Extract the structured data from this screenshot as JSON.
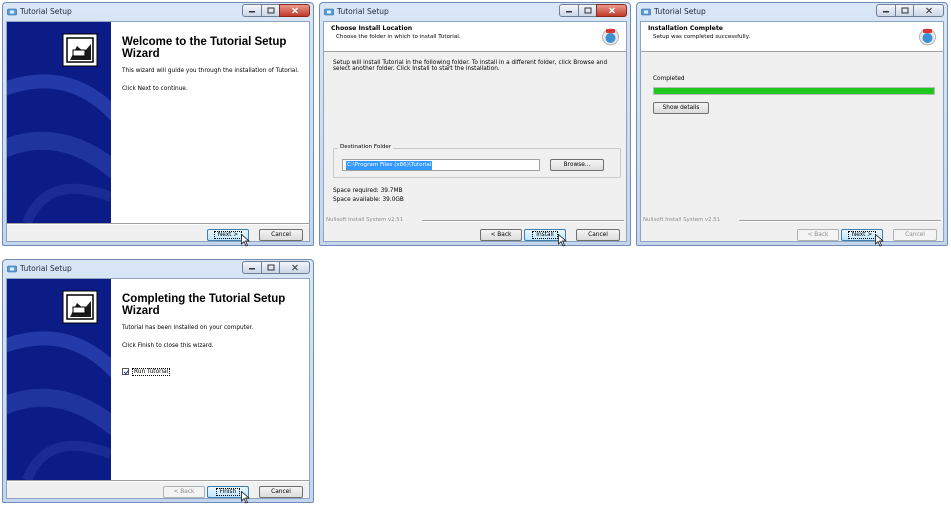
{
  "colors": {
    "side_panel": "#0c1c86",
    "progress_fill": "#1ec81e",
    "selection": "#3399ff"
  },
  "windows": {
    "welcome": {
      "title": "Tutorial Setup",
      "heading": "Welcome to the Tutorial Setup Wizard",
      "body1": "This wizard will guide you through the installation of Tutorial.",
      "body2": "Click Next to continue.",
      "next": "Next >",
      "cancel": "Cancel"
    },
    "location": {
      "title": "Tutorial Setup",
      "header_title": "Choose Install Location",
      "header_sub": "Choose the folder in which to install Tutorial.",
      "body": "Setup will install Tutorial in the following folder. To install in a different folder, click Browse and select another folder. Click Install to start the installation.",
      "dest_label": "Destination Folder",
      "dest_value": "C:\\Program Files (x86)\\Tutorial",
      "browse": "Browse...",
      "space_required": "Space required: 39.7MB",
      "space_available": "Space available: 39.0GB",
      "branding": "Nullsoft Install System v2.51",
      "back": "< Back",
      "install": "Install",
      "cancel": "Cancel"
    },
    "complete": {
      "title": "Tutorial Setup",
      "header_title": "Installation Complete",
      "header_sub": "Setup was completed successfully.",
      "status": "Completed",
      "progress_percent": 100,
      "show_details": "Show details",
      "branding": "Nullsoft Install System v2.51",
      "back": "< Back",
      "next": "Next >",
      "cancel": "Cancel"
    },
    "finish": {
      "title": "Tutorial Setup",
      "heading": "Completing the Tutorial Setup Wizard",
      "body1": "Tutorial has been installed on your computer.",
      "body2": "Click Finish to close this wizard.",
      "run_label": "Run Tutorial",
      "run_checked": true,
      "back": "< Back",
      "finish": "Finish",
      "cancel": "Cancel"
    }
  }
}
